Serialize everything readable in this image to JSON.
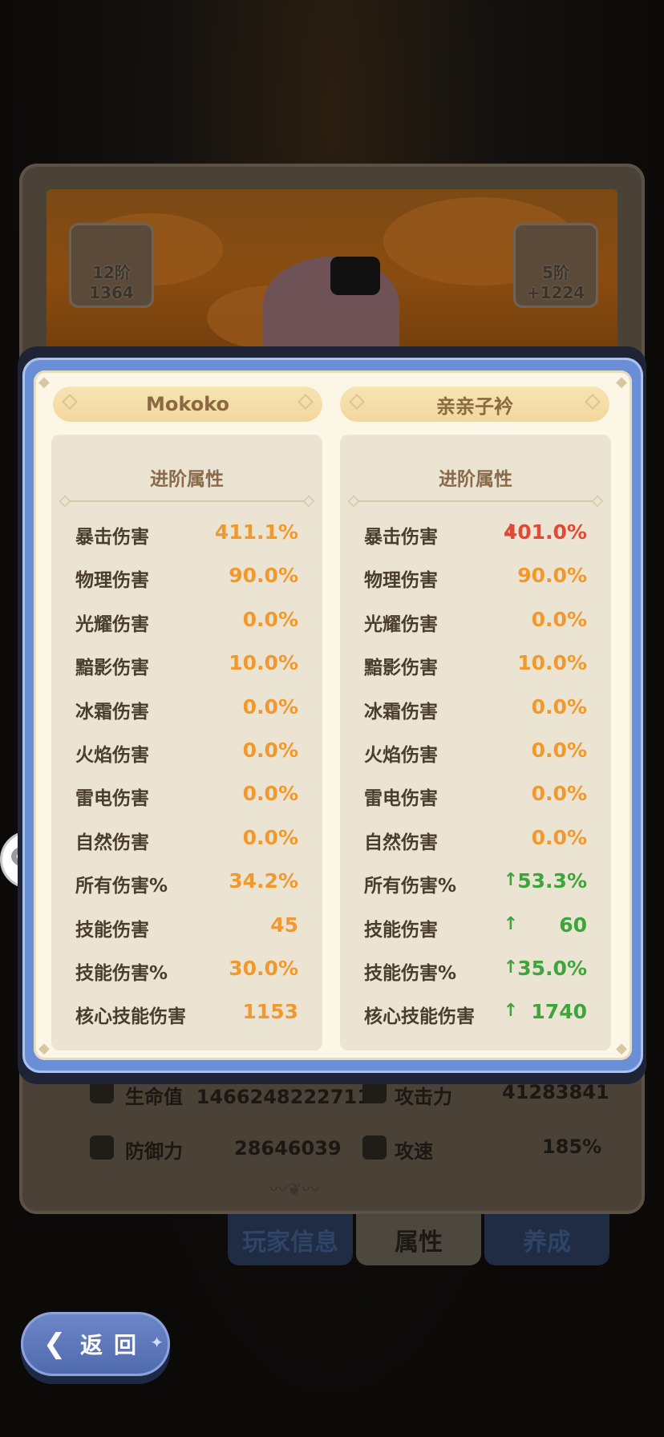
{
  "background": {
    "slot_left_label": "12阶1364",
    "slot_right_label": "5阶+1224",
    "stats": [
      {
        "label": "生命值",
        "value": "1466248222711"
      },
      {
        "label": "攻击力",
        "value": "41283841"
      },
      {
        "label": "防御力",
        "value": "28646039"
      },
      {
        "label": "攻速",
        "value": "185%"
      }
    ],
    "tabs": {
      "player": "玩家信息",
      "attributes": "属性",
      "growth": "养成"
    }
  },
  "back_button": {
    "label": "返回"
  },
  "left_player": {
    "name": "Mokoko",
    "section_title": "进阶属性",
    "rows": [
      {
        "label": "暴击伤害",
        "value": "411.1%"
      },
      {
        "label": "物理伤害",
        "value": "90.0%"
      },
      {
        "label": "光耀伤害",
        "value": "0.0%"
      },
      {
        "label": "黯影伤害",
        "value": "10.0%"
      },
      {
        "label": "冰霜伤害",
        "value": "0.0%"
      },
      {
        "label": "火焰伤害",
        "value": "0.0%"
      },
      {
        "label": "雷电伤害",
        "value": "0.0%"
      },
      {
        "label": "自然伤害",
        "value": "0.0%"
      },
      {
        "label": "所有伤害%",
        "value": "34.2%"
      },
      {
        "label": "技能伤害",
        "value": "45"
      },
      {
        "label": "技能伤害%",
        "value": "30.0%"
      },
      {
        "label": "核心技能伤害",
        "value": "1153"
      }
    ]
  },
  "right_player": {
    "name": "亲亲子衿",
    "section_title": "进阶属性",
    "rows": [
      {
        "label": "暴击伤害",
        "value": "401.0%",
        "trend": "down"
      },
      {
        "label": "物理伤害",
        "value": "90.0%",
        "trend": "same"
      },
      {
        "label": "光耀伤害",
        "value": "0.0%",
        "trend": "same"
      },
      {
        "label": "黯影伤害",
        "value": "10.0%",
        "trend": "same"
      },
      {
        "label": "冰霜伤害",
        "value": "0.0%",
        "trend": "same"
      },
      {
        "label": "火焰伤害",
        "value": "0.0%",
        "trend": "same"
      },
      {
        "label": "雷电伤害",
        "value": "0.0%",
        "trend": "same"
      },
      {
        "label": "自然伤害",
        "value": "0.0%",
        "trend": "same"
      },
      {
        "label": "所有伤害%",
        "value": "53.3%",
        "trend": "up"
      },
      {
        "label": "技能伤害",
        "value": "60",
        "trend": "up"
      },
      {
        "label": "技能伤害%",
        "value": "35.0%",
        "trend": "up"
      },
      {
        "label": "核心技能伤害",
        "value": "1740",
        "trend": "up"
      }
    ]
  },
  "icons": {
    "arrow_up": "↑",
    "arrow_down": "↓",
    "back": "❮",
    "chat": "chat-bubbles-icon"
  },
  "colors": {
    "value_orange": "#f0992f",
    "up_green": "#3ea43c",
    "down_red": "#e24a35",
    "frame_blue": "#6b8fd6"
  }
}
